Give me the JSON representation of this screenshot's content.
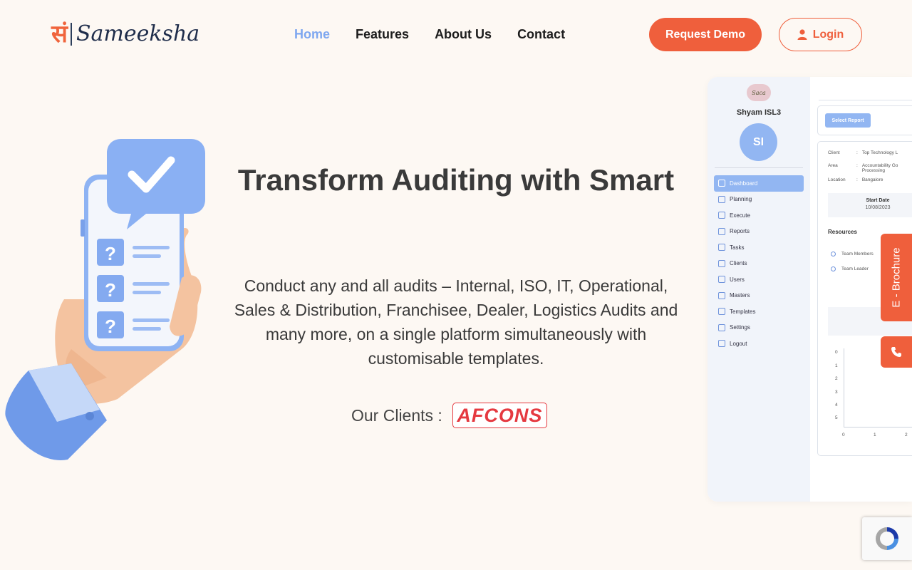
{
  "brand": {
    "logo_mark": "सं",
    "name": "Sameeksha"
  },
  "nav": {
    "items": [
      {
        "label": "Home",
        "active": true
      },
      {
        "label": "Features",
        "active": false
      },
      {
        "label": "About Us",
        "active": false
      },
      {
        "label": "Contact",
        "active": false
      }
    ]
  },
  "header": {
    "request_demo_label": "Request Demo",
    "login_label": "Login"
  },
  "hero": {
    "title": "Transform Auditing with Smart",
    "description": "Conduct any and all audits – Internal, ISO, IT, Operational, Sales & Distribution, Franchisee, Dealer, Logistics Audits and many more, on a single platform simultaneously with customisable templates.",
    "clients_label": "Our Clients :",
    "client_logo_text": "AFCONS"
  },
  "dashboard_preview": {
    "brand": "Saca",
    "user_name": "Shyam ISL3",
    "avatar_initials": "SI",
    "menu": [
      {
        "label": "Dashboard",
        "active": true
      },
      {
        "label": "Planning",
        "active": false
      },
      {
        "label": "Execute",
        "active": false
      },
      {
        "label": "Reports",
        "active": false
      },
      {
        "label": "Tasks",
        "active": false
      },
      {
        "label": "Clients",
        "active": false
      },
      {
        "label": "Users",
        "active": false
      },
      {
        "label": "Masters",
        "active": false
      },
      {
        "label": "Templates",
        "active": false
      },
      {
        "label": "Settings",
        "active": false
      },
      {
        "label": "Logout",
        "active": false
      }
    ],
    "select_report_label": "Select Report",
    "details": [
      {
        "key": "Client",
        "value": "Top Technology L"
      },
      {
        "key": "Area",
        "value": "Accountability Go Processing"
      },
      {
        "key": "Location",
        "value": "Bangalore"
      }
    ],
    "start_date_label": "Start Date",
    "start_date_value": "10/08/2023",
    "resources_label": "Resources",
    "resources": [
      "Team Members",
      "Team Leader"
    ],
    "y_ticks": [
      "0",
      "1",
      "2",
      "3",
      "4",
      "5"
    ],
    "x_ticks": [
      "0",
      "1",
      "2"
    ]
  },
  "widgets": {
    "brochure_label": "E - Brochure",
    "phone_icon": "phone-icon",
    "recaptcha_icon": "recaptcha-icon"
  },
  "colors": {
    "accent": "#ef5f3c",
    "nav_active": "#7ea7f0",
    "background": "#fdf8f3",
    "dashboard_accent": "#92b6f2"
  }
}
